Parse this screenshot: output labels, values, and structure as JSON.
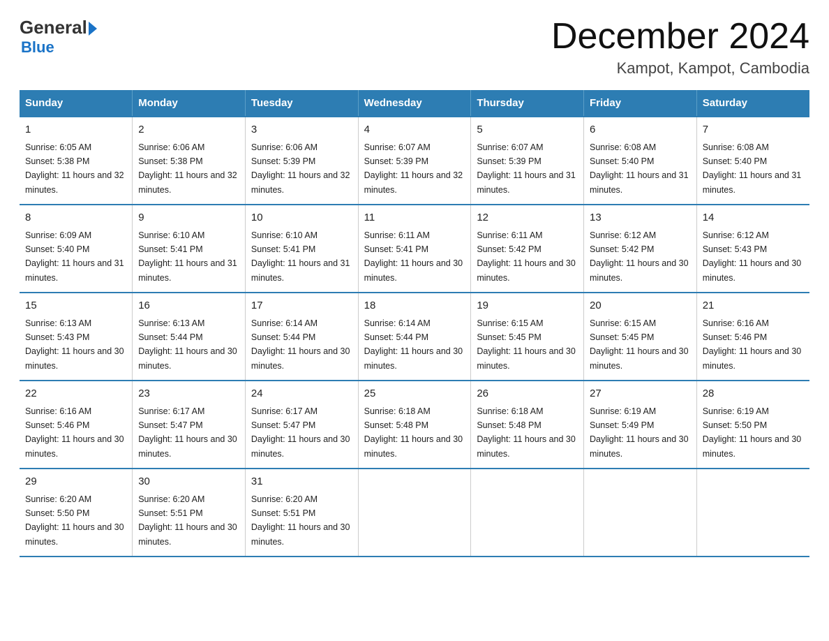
{
  "logo": {
    "general": "General",
    "blue": "Blue"
  },
  "title": "December 2024",
  "subtitle": "Kampot, Kampot, Cambodia",
  "days_header": [
    "Sunday",
    "Monday",
    "Tuesday",
    "Wednesday",
    "Thursday",
    "Friday",
    "Saturday"
  ],
  "weeks": [
    [
      {
        "num": "1",
        "sunrise": "6:05 AM",
        "sunset": "5:38 PM",
        "daylight": "11 hours and 32 minutes."
      },
      {
        "num": "2",
        "sunrise": "6:06 AM",
        "sunset": "5:38 PM",
        "daylight": "11 hours and 32 minutes."
      },
      {
        "num": "3",
        "sunrise": "6:06 AM",
        "sunset": "5:39 PM",
        "daylight": "11 hours and 32 minutes."
      },
      {
        "num": "4",
        "sunrise": "6:07 AM",
        "sunset": "5:39 PM",
        "daylight": "11 hours and 32 minutes."
      },
      {
        "num": "5",
        "sunrise": "6:07 AM",
        "sunset": "5:39 PM",
        "daylight": "11 hours and 31 minutes."
      },
      {
        "num": "6",
        "sunrise": "6:08 AM",
        "sunset": "5:40 PM",
        "daylight": "11 hours and 31 minutes."
      },
      {
        "num": "7",
        "sunrise": "6:08 AM",
        "sunset": "5:40 PM",
        "daylight": "11 hours and 31 minutes."
      }
    ],
    [
      {
        "num": "8",
        "sunrise": "6:09 AM",
        "sunset": "5:40 PM",
        "daylight": "11 hours and 31 minutes."
      },
      {
        "num": "9",
        "sunrise": "6:10 AM",
        "sunset": "5:41 PM",
        "daylight": "11 hours and 31 minutes."
      },
      {
        "num": "10",
        "sunrise": "6:10 AM",
        "sunset": "5:41 PM",
        "daylight": "11 hours and 31 minutes."
      },
      {
        "num": "11",
        "sunrise": "6:11 AM",
        "sunset": "5:41 PM",
        "daylight": "11 hours and 30 minutes."
      },
      {
        "num": "12",
        "sunrise": "6:11 AM",
        "sunset": "5:42 PM",
        "daylight": "11 hours and 30 minutes."
      },
      {
        "num": "13",
        "sunrise": "6:12 AM",
        "sunset": "5:42 PM",
        "daylight": "11 hours and 30 minutes."
      },
      {
        "num": "14",
        "sunrise": "6:12 AM",
        "sunset": "5:43 PM",
        "daylight": "11 hours and 30 minutes."
      }
    ],
    [
      {
        "num": "15",
        "sunrise": "6:13 AM",
        "sunset": "5:43 PM",
        "daylight": "11 hours and 30 minutes."
      },
      {
        "num": "16",
        "sunrise": "6:13 AM",
        "sunset": "5:44 PM",
        "daylight": "11 hours and 30 minutes."
      },
      {
        "num": "17",
        "sunrise": "6:14 AM",
        "sunset": "5:44 PM",
        "daylight": "11 hours and 30 minutes."
      },
      {
        "num": "18",
        "sunrise": "6:14 AM",
        "sunset": "5:44 PM",
        "daylight": "11 hours and 30 minutes."
      },
      {
        "num": "19",
        "sunrise": "6:15 AM",
        "sunset": "5:45 PM",
        "daylight": "11 hours and 30 minutes."
      },
      {
        "num": "20",
        "sunrise": "6:15 AM",
        "sunset": "5:45 PM",
        "daylight": "11 hours and 30 minutes."
      },
      {
        "num": "21",
        "sunrise": "6:16 AM",
        "sunset": "5:46 PM",
        "daylight": "11 hours and 30 minutes."
      }
    ],
    [
      {
        "num": "22",
        "sunrise": "6:16 AM",
        "sunset": "5:46 PM",
        "daylight": "11 hours and 30 minutes."
      },
      {
        "num": "23",
        "sunrise": "6:17 AM",
        "sunset": "5:47 PM",
        "daylight": "11 hours and 30 minutes."
      },
      {
        "num": "24",
        "sunrise": "6:17 AM",
        "sunset": "5:47 PM",
        "daylight": "11 hours and 30 minutes."
      },
      {
        "num": "25",
        "sunrise": "6:18 AM",
        "sunset": "5:48 PM",
        "daylight": "11 hours and 30 minutes."
      },
      {
        "num": "26",
        "sunrise": "6:18 AM",
        "sunset": "5:48 PM",
        "daylight": "11 hours and 30 minutes."
      },
      {
        "num": "27",
        "sunrise": "6:19 AM",
        "sunset": "5:49 PM",
        "daylight": "11 hours and 30 minutes."
      },
      {
        "num": "28",
        "sunrise": "6:19 AM",
        "sunset": "5:50 PM",
        "daylight": "11 hours and 30 minutes."
      }
    ],
    [
      {
        "num": "29",
        "sunrise": "6:20 AM",
        "sunset": "5:50 PM",
        "daylight": "11 hours and 30 minutes."
      },
      {
        "num": "30",
        "sunrise": "6:20 AM",
        "sunset": "5:51 PM",
        "daylight": "11 hours and 30 minutes."
      },
      {
        "num": "31",
        "sunrise": "6:20 AM",
        "sunset": "5:51 PM",
        "daylight": "11 hours and 30 minutes."
      },
      null,
      null,
      null,
      null
    ]
  ]
}
